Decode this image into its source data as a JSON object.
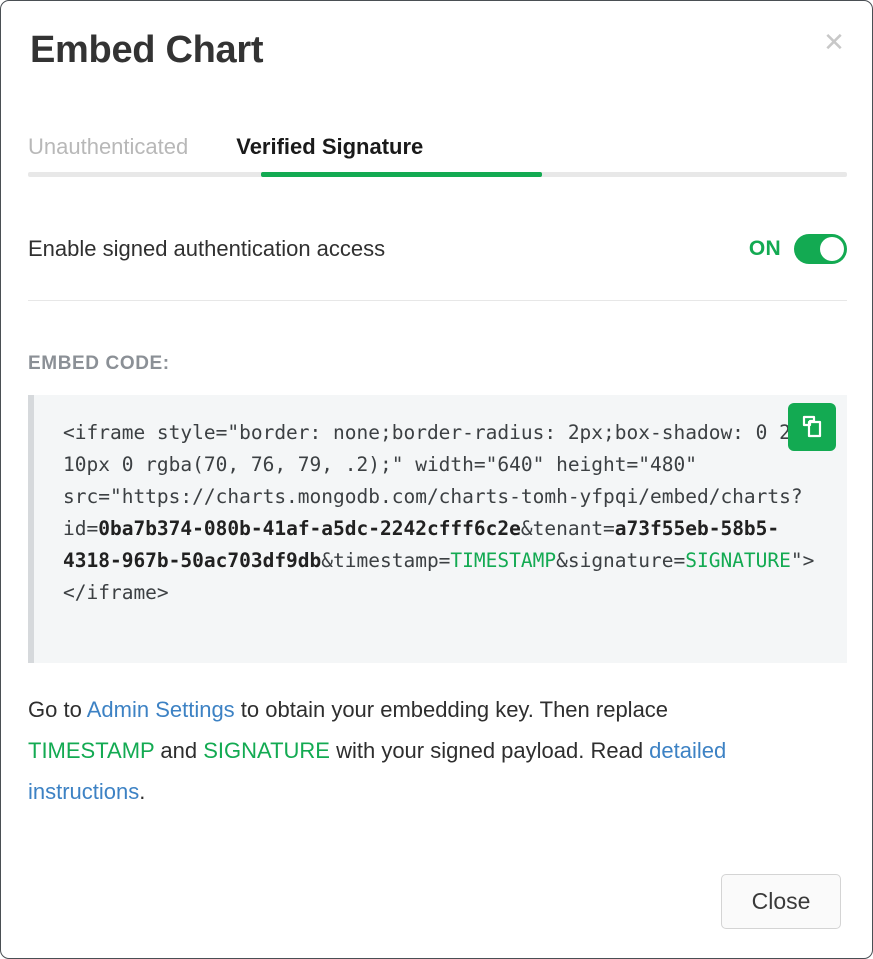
{
  "dialog": {
    "title": "Embed Chart",
    "close_icon": "close-icon"
  },
  "tabs": [
    {
      "label": "Unauthenticated",
      "active": false
    },
    {
      "label": "Verified Signature",
      "active": true
    }
  ],
  "toggle": {
    "label": "Enable signed authentication access",
    "state_label": "ON",
    "on": true,
    "accent_color": "#13aa52"
  },
  "embed": {
    "section_label": "EMBED CODE:",
    "copy_icon": "copy-icon",
    "code_plain": "<iframe style=\"border: none;border-radius: 2px;box-shadow: 0 2px 10px 0 rgba(70, 76, 79, .2);\" width=\"640\" height=\"480\" src=\"https://charts.mongodb.com/charts-tomh-yfpqi/embed/charts?id=0ba7b374-080b-41af-a5dc-2242cfff6c2e&tenant=a73f55eb-58b5-4318-967b-50ac703df9db&timestamp=TIMESTAMP&signature=SIGNATURE\"></iframe>",
    "segments": [
      {
        "text": "<iframe style=\"border: none;border-radius: 2px;box-shadow: 0 2px 10px 0 rgba(70, 76, 79, .2);\" width=\"640\" height=\"480\" src=\"https://charts.mongodb.com/charts-tomh-yfpqi/embed/charts?id=",
        "style": "plain"
      },
      {
        "text": "0ba7b374-080b-41af-a5dc-2242cfff6c2e",
        "style": "bold"
      },
      {
        "text": "&tenant=",
        "style": "plain"
      },
      {
        "text": "a73f55eb-58b5-4318-967b-50ac703df9db",
        "style": "bold"
      },
      {
        "text": "&timestamp=",
        "style": "plain"
      },
      {
        "text": "TIMESTAMP",
        "style": "green"
      },
      {
        "text": "&signature=",
        "style": "plain"
      },
      {
        "text": "SIGNATURE",
        "style": "green"
      },
      {
        "text": "\"></iframe>",
        "style": "plain"
      }
    ],
    "chart_id": "0ba7b374-080b-41af-a5dc-2242cfff6c2e",
    "tenant_id": "a73f55eb-58b5-4318-967b-50ac703df9db",
    "iframe_width": "640",
    "iframe_height": "480",
    "base_url": "https://charts.mongodb.com/charts-tomh-yfpqi/embed/charts"
  },
  "note": {
    "part1": "Go to ",
    "link_admin_settings": "Admin Settings",
    "part2": " to obtain your embedding key. Then replace ",
    "token_timestamp": "TIMESTAMP",
    "part3": " and ",
    "token_signature": "SIGNATURE",
    "part4": " with your signed payload. Read ",
    "link_detailed": "detailed instructions",
    "part5": "."
  },
  "footer": {
    "close_label": "Close"
  },
  "colors": {
    "accent_green": "#13aa52",
    "link_blue": "#3d82c4",
    "code_bg": "#f4f6f7",
    "muted_gray": "#8b9096"
  }
}
